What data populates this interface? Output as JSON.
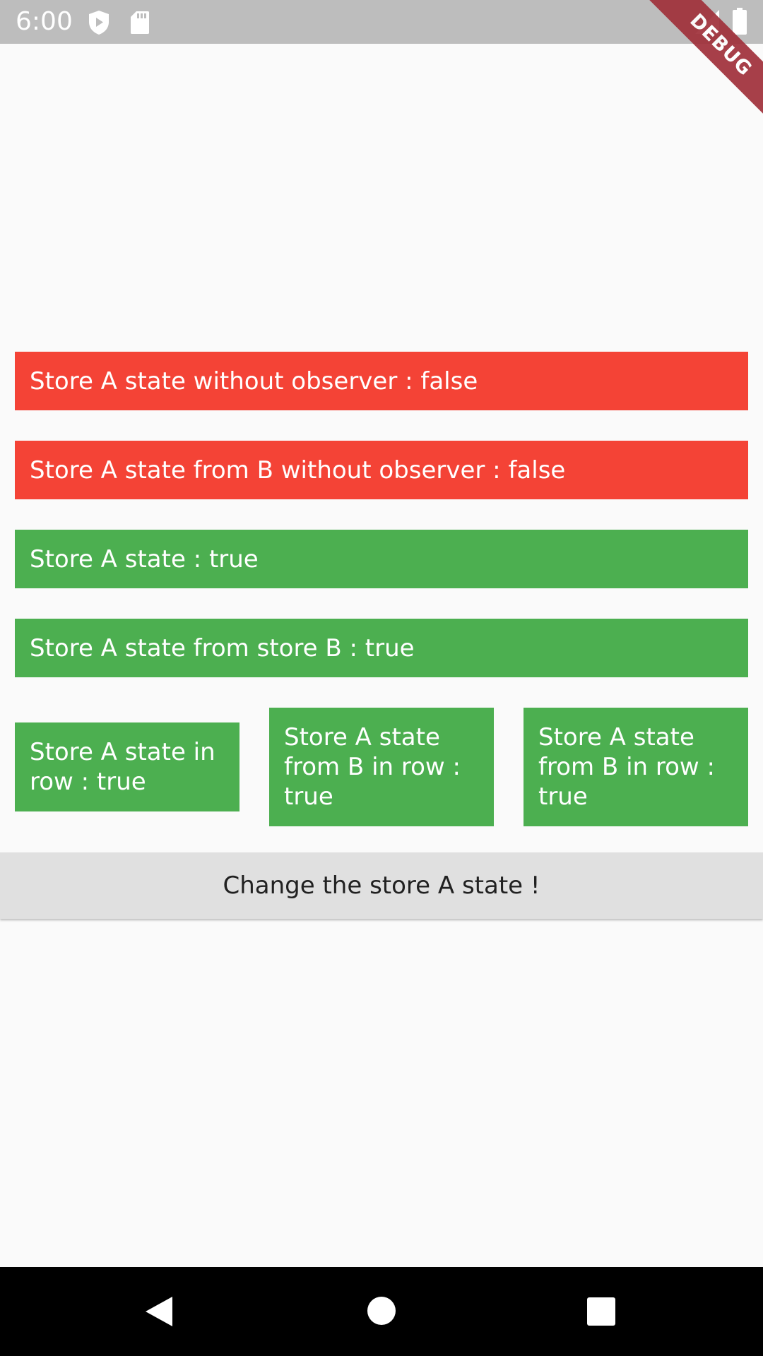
{
  "status_bar": {
    "time": "6:00",
    "icons": [
      "play-protect-icon",
      "sd-card-icon",
      "signal-icon",
      "battery-icon"
    ]
  },
  "debug_banner": {
    "label": "DEBUG",
    "color": "#a0303a"
  },
  "cards": {
    "without_observer": {
      "label": "Store A state without observer : false",
      "color": "#f44336"
    },
    "from_b_without_observer": {
      "label": "Store A state from B without observer : false",
      "color": "#f44336"
    },
    "state": {
      "label": "Store A state : true",
      "color": "#4caf50"
    },
    "from_store_b": {
      "label": "Store A state from store B : true",
      "color": "#4caf50"
    },
    "row": [
      {
        "label": "Store A state in row : true",
        "color": "#4caf50"
      },
      {
        "label": "Store A state from B in row : true",
        "color": "#4caf50"
      },
      {
        "label": "Store A state from B in row : true",
        "color": "#4caf50"
      }
    ]
  },
  "action_button": {
    "label": "Change the store A state !"
  },
  "nav_bar": {
    "buttons": [
      "back-icon",
      "home-icon",
      "recents-icon"
    ]
  }
}
